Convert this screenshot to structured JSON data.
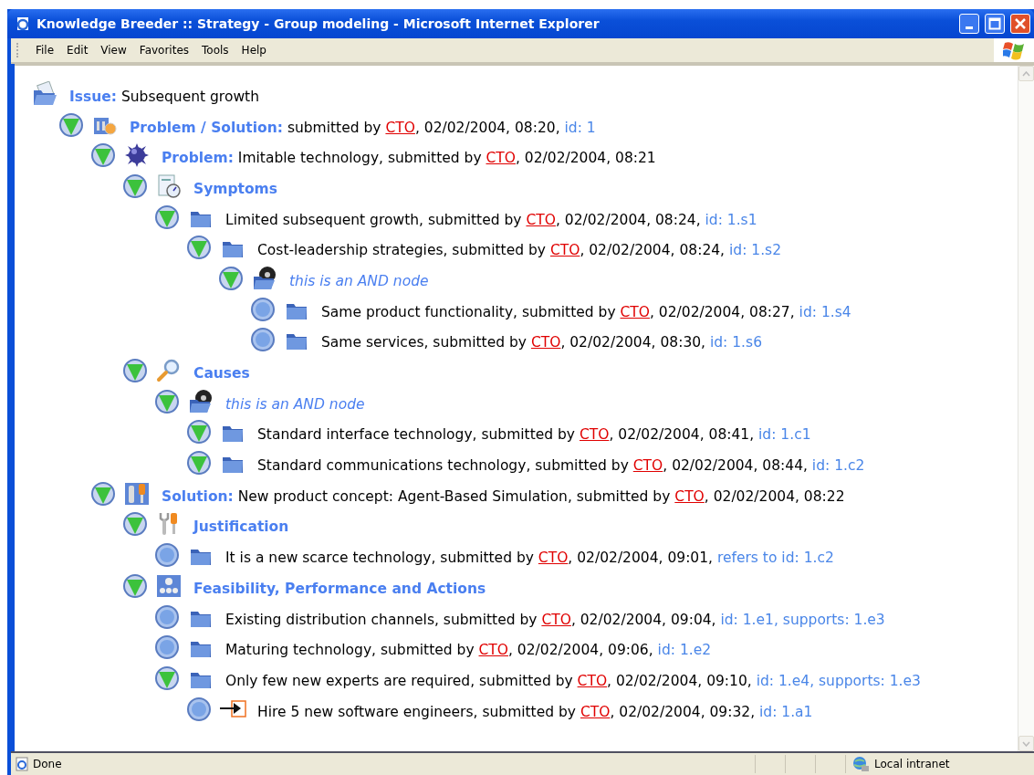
{
  "window": {
    "title": "Knowledge Breeder :: Strategy - Group modeling - Microsoft Internet Explorer"
  },
  "menu": [
    "File",
    "Edit",
    "View",
    "Favorites",
    "Tools",
    "Help"
  ],
  "issue": {
    "kind": "issue",
    "label": "Issue:",
    "text": "Subsequent growth",
    "children": [
      {
        "kind": "problem-solution",
        "expanded": true,
        "label": "Problem / Solution:",
        "text": "submitted by ",
        "author": "CTO",
        "after": ", 02/02/2004, 08:20, ",
        "ref": "id: 1",
        "children": [
          {
            "kind": "problem",
            "expanded": true,
            "label": "Problem:",
            "text": "Imitable technology, submitted by ",
            "author": "CTO",
            "after": ", 02/02/2004, 08:21",
            "children": [
              {
                "kind": "symptoms",
                "expanded": true,
                "label": "Symptoms",
                "children": [
                  {
                    "kind": "folder",
                    "expanded": true,
                    "text": "Limited subsequent growth, submitted by ",
                    "author": "CTO",
                    "after": ", 02/02/2004, 08:24, ",
                    "ref": "id: 1.s1",
                    "children": [
                      {
                        "kind": "folder",
                        "expanded": true,
                        "text": "Cost-leadership strategies, submitted by ",
                        "author": "CTO",
                        "after": ", 02/02/2004, 08:24, ",
                        "ref": "id: 1.s2",
                        "children": [
                          {
                            "kind": "and-node",
                            "expanded": true,
                            "text": "this is an AND node",
                            "children": [
                              {
                                "kind": "folder",
                                "expanded": false,
                                "text": "Same product functionality, submitted by ",
                                "author": "CTO",
                                "after": ", 02/02/2004, 08:27, ",
                                "ref": "id: 1.s4"
                              },
                              {
                                "kind": "folder",
                                "expanded": false,
                                "text": "Same services, submitted by ",
                                "author": "CTO",
                                "after": ", 02/02/2004, 08:30, ",
                                "ref": "id: 1.s6"
                              }
                            ]
                          }
                        ]
                      }
                    ]
                  }
                ]
              },
              {
                "kind": "causes",
                "expanded": true,
                "label": "Causes",
                "children": [
                  {
                    "kind": "and-node",
                    "expanded": true,
                    "text": "this is an AND node",
                    "children": [
                      {
                        "kind": "folder",
                        "expanded": true,
                        "text": "Standard interface technology, submitted by ",
                        "author": "CTO",
                        "after": ", 02/02/2004, 08:41, ",
                        "ref": "id: 1.c1"
                      },
                      {
                        "kind": "folder",
                        "expanded": true,
                        "text": "Standard communications technology, submitted by ",
                        "author": "CTO",
                        "after": ", 02/02/2004, 08:44, ",
                        "ref": "id: 1.c2"
                      }
                    ]
                  }
                ]
              }
            ]
          },
          {
            "kind": "solution",
            "expanded": true,
            "label": "Solution:",
            "text": "New product concept: Agent-Based Simulation, submitted by ",
            "author": "CTO",
            "after": ", 02/02/2004, 08:22",
            "children": [
              {
                "kind": "justification",
                "expanded": true,
                "label": "Justification",
                "children": [
                  {
                    "kind": "folder",
                    "expanded": false,
                    "text": "It is a new scarce technology, submitted by ",
                    "author": "CTO",
                    "after": ", 02/02/2004, 09:01, ",
                    "ref": "refers to id: 1.c2"
                  }
                ]
              },
              {
                "kind": "feasibility",
                "expanded": true,
                "label": "Feasibility, Performance and Actions",
                "children": [
                  {
                    "kind": "folder",
                    "expanded": false,
                    "text": "Existing distribution channels, submitted by ",
                    "author": "CTO",
                    "after": ", 02/02/2004, 09:04, ",
                    "ref": "id: 1.e1, supports: 1.e3"
                  },
                  {
                    "kind": "folder",
                    "expanded": false,
                    "text": "Maturing technology, submitted by ",
                    "author": "CTO",
                    "after": ", 02/02/2004, 09:06, ",
                    "ref": "id: 1.e2"
                  },
                  {
                    "kind": "folder",
                    "expanded": true,
                    "text": "Only few new experts are required, submitted by ",
                    "author": "CTO",
                    "after": ", 02/02/2004, 09:10, ",
                    "ref": "id: 1.e4, supports: 1.e3",
                    "children": [
                      {
                        "kind": "action",
                        "expanded": false,
                        "text": "Hire 5 new software engineers, submitted by ",
                        "author": "CTO",
                        "after": ", 02/02/2004, 09:32, ",
                        "ref": "id: 1.a1"
                      }
                    ]
                  }
                ]
              }
            ]
          }
        ]
      }
    ]
  },
  "status_bar": {
    "text": "Done",
    "zone": "Local intranet"
  }
}
